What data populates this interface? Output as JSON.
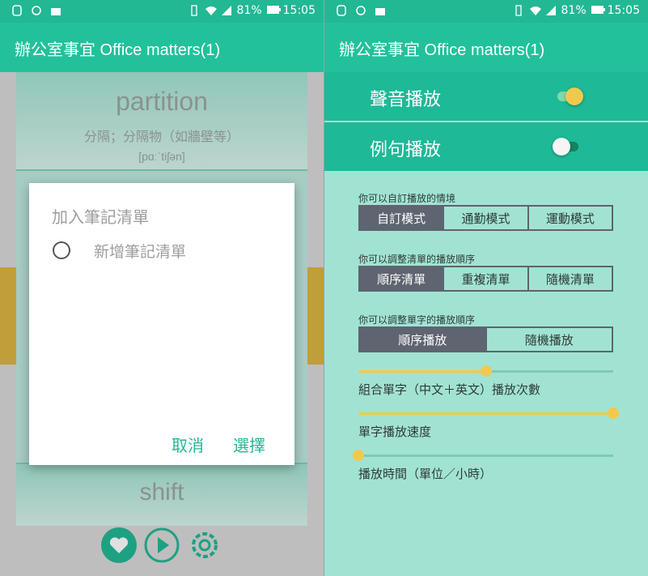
{
  "status_bar": {
    "battery": "81%",
    "time": "15:05"
  },
  "app_title": "辦公室事宜 Office matters(1)",
  "left": {
    "card_top": {
      "word": "partition",
      "meaning": "分隔；分隔物（如牆壁等）",
      "phonetic": "[pɑːˈtiʃən]"
    },
    "card_bottom": {
      "word": "shift"
    },
    "dialog": {
      "title": "加入筆記清單",
      "option": "新增筆記清單",
      "cancel": "取消",
      "select": "選擇"
    },
    "bottom_icons": [
      "heart-icon",
      "play-icon",
      "gear-icon"
    ]
  },
  "right": {
    "sound": {
      "label": "聲音播放",
      "on": true
    },
    "example": {
      "label": "例句播放",
      "on": false
    },
    "scenario": {
      "title": "你可以自訂播放的情境",
      "options": [
        "自訂模式",
        "通勤模式",
        "運動模式"
      ],
      "selected": 0
    },
    "list_order": {
      "title": "你可以調整清單的播放順序",
      "options": [
        "順序清單",
        "重複清單",
        "隨機清單"
      ],
      "selected": 0
    },
    "word_order": {
      "title": "你可以調整單字的播放順序",
      "options": [
        "順序播放",
        "隨機播放"
      ],
      "selected": 0
    },
    "sliders": [
      {
        "label": "組合單字（中文＋英文）播放次數",
        "value": 0.5
      },
      {
        "label": "單字播放速度",
        "value": 1.0
      },
      {
        "label": "播放時間（單位／小時）",
        "value": 0.0
      }
    ]
  },
  "colors": {
    "accent": "#22c19b",
    "toggle_on": "#f2c94c",
    "segment_selected": "#5e6470"
  }
}
